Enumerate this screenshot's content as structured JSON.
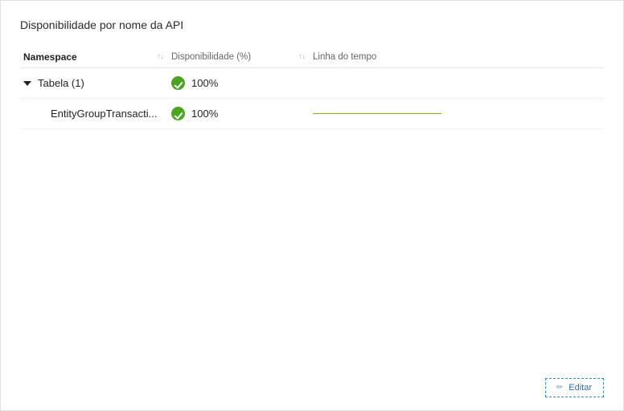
{
  "title": "Disponibilidade por nome da API",
  "columns": {
    "namespace": "Namespace",
    "availability": "Disponibilidade (%)",
    "timeline": "Linha do tempo"
  },
  "rows": {
    "group": {
      "label": "Tabela (1)",
      "availability": "100%"
    },
    "child": {
      "label": "EntityGroupTransacti...",
      "availability": "100%"
    }
  },
  "footer": {
    "edit_label": "Editar",
    "edit_glyph": "✎"
  },
  "status_icon": "check-icon",
  "status_color": "#4aa61f",
  "spark_color": "#7fba00"
}
